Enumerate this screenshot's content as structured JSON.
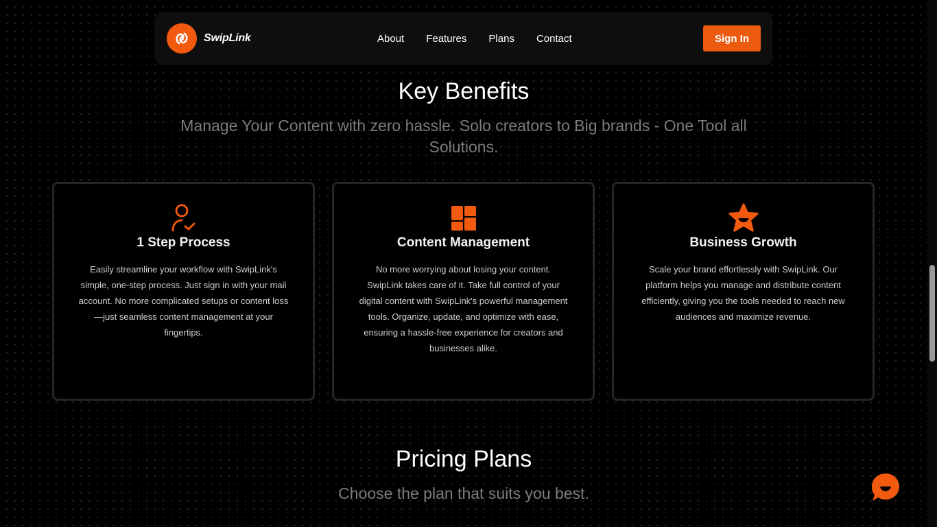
{
  "nav": {
    "brand": "SwipLink",
    "links": [
      "About",
      "Features",
      "Plans",
      "Contact"
    ],
    "signin_label": "Sign In"
  },
  "benefits": {
    "title": "Key Benefits",
    "subtitle": "Manage Your Content with zero hassle. Solo creators to Big brands - One Tool all Solutions.",
    "cards": [
      {
        "icon": "user-check-icon",
        "title": "1 Step Process",
        "description": "Easily streamline your workflow with SwipLink's simple, one-step process. Just sign in with your mail account. No more complicated setups or content loss—just seamless content management at your fingertips."
      },
      {
        "icon": "dashboard-tiles-icon",
        "title": "Content Management",
        "description": "No more worrying about losing your content. SwipLink takes care of it. Take full control of your digital content with SwipLink's powerful management tools. Organize, update, and optimize with ease, ensuring a hassle-free experience for creators and businesses alike."
      },
      {
        "icon": "star-smile-icon",
        "title": "Business Growth",
        "description": "Scale your brand effortlessly with SwipLink. Our platform helps you manage and distribute content efficiently, giving you the tools needed to reach new audiences and maximize revenue."
      }
    ]
  },
  "pricing": {
    "title": "Pricing Plans",
    "subtitle": "Choose the plan that suits you best."
  },
  "colors": {
    "accent": "#f25a0f",
    "background": "#000000",
    "navbar": "#0e0e0e",
    "card_border": "#262626",
    "muted_text": "#7c7c7c"
  },
  "widgets": {
    "chat_icon": "chat-smile-icon"
  }
}
